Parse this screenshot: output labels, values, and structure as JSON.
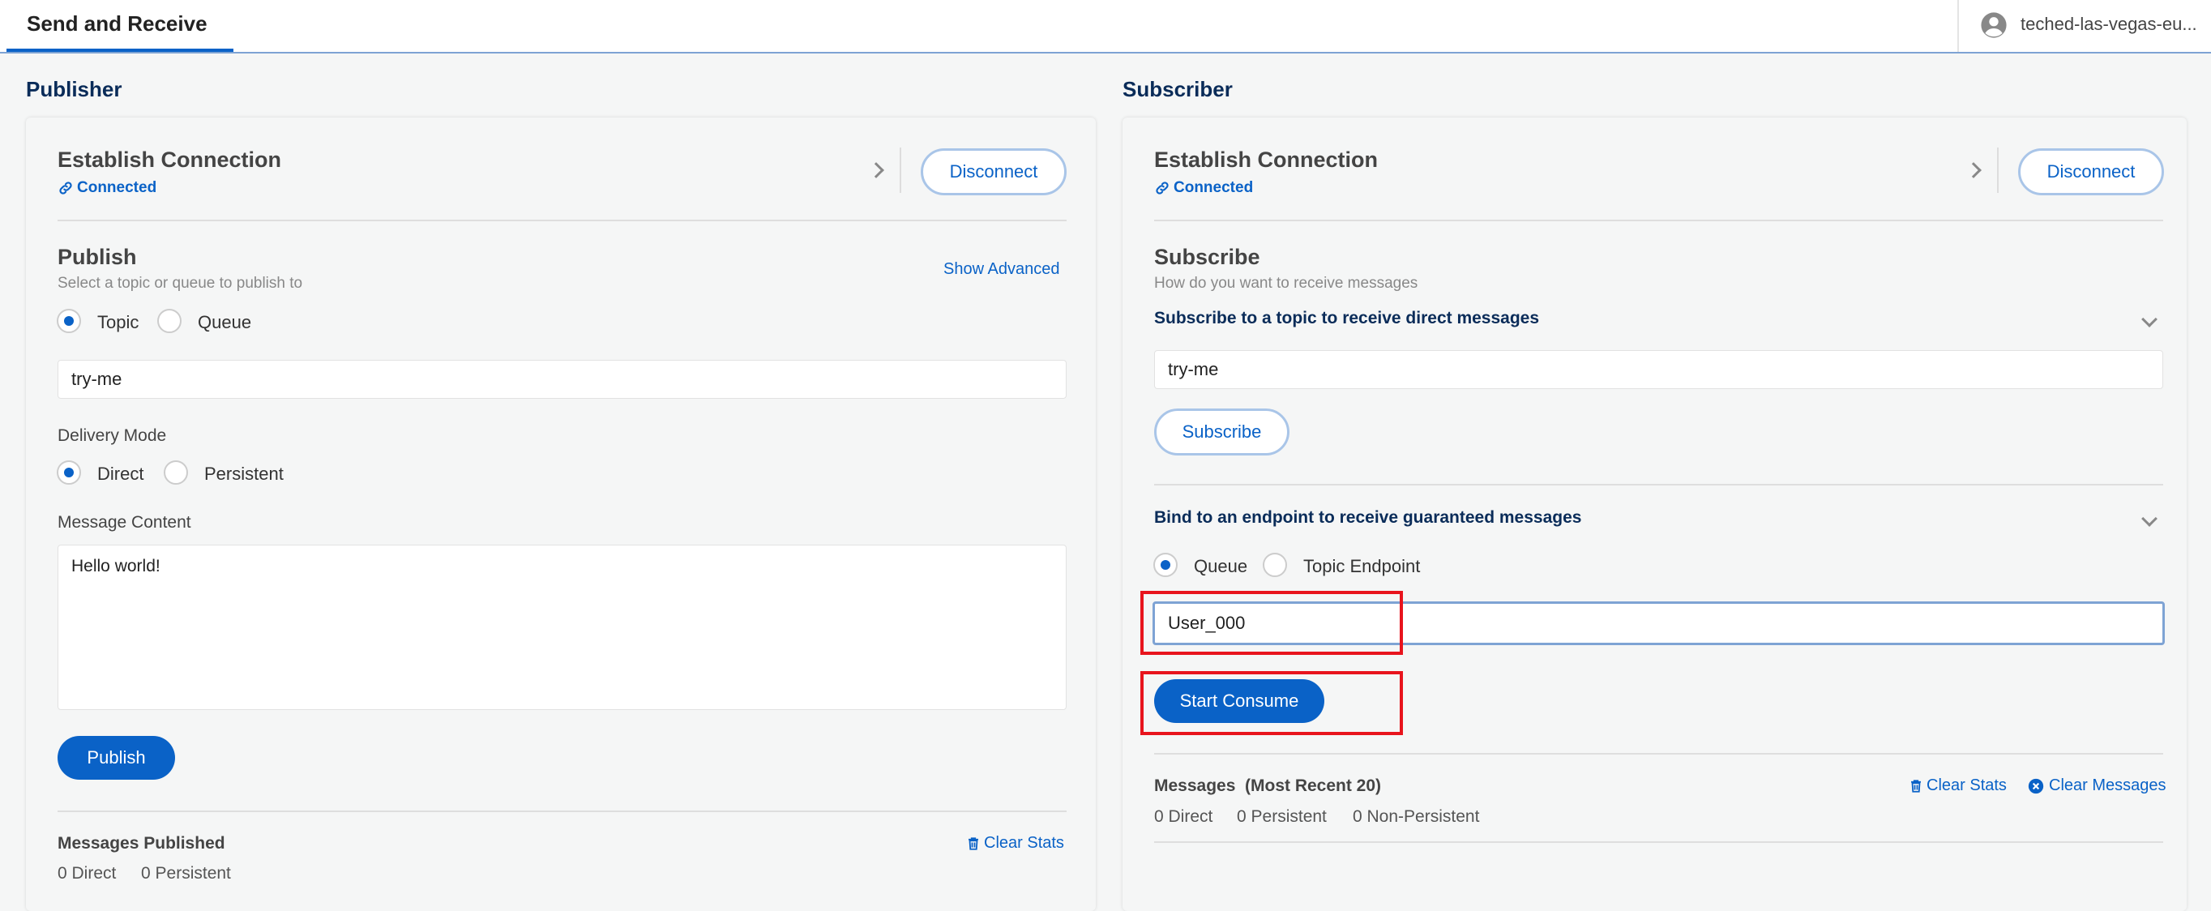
{
  "header": {
    "tab": "Send and Receive",
    "user": "teched-las-vegas-eu..."
  },
  "publisher": {
    "title": "Publisher",
    "connection_title": "Establish Connection",
    "connection_status": "Connected",
    "disconnect_label": "Disconnect",
    "publish_title": "Publish",
    "publish_subtitle": "Select a topic or queue to publish to",
    "show_advanced": "Show Advanced",
    "dest_options": [
      "Topic",
      "Queue"
    ],
    "dest_selected": "Topic",
    "topic_value": "try-me",
    "delivery_mode_label": "Delivery Mode",
    "delivery_options": [
      "Direct",
      "Persistent"
    ],
    "delivery_selected": "Direct",
    "message_content_label": "Message Content",
    "message_content": "Hello world!",
    "publish_button": "Publish",
    "stats_title": "Messages Published",
    "clear_stats": "Clear Stats",
    "stats_direct": "0 Direct",
    "stats_persistent": "0 Persistent"
  },
  "subscriber": {
    "title": "Subscriber",
    "connection_title": "Establish Connection",
    "connection_status": "Connected",
    "disconnect_label": "Disconnect",
    "subscribe_title": "Subscribe",
    "subscribe_subtitle": "How do you want to receive messages",
    "direct_heading": "Subscribe to a topic to receive direct messages",
    "topic_value": "try-me",
    "subscribe_button": "Subscribe",
    "guaranteed_heading": "Bind to an endpoint to receive guaranteed messages",
    "endpoint_options": [
      "Queue",
      "Topic Endpoint"
    ],
    "endpoint_selected": "Queue",
    "queue_value": "User_000",
    "start_consume_button": "Start Consume",
    "messages_title": "Messages",
    "messages_subtitle": "(Most Recent 20)",
    "clear_stats": "Clear Stats",
    "clear_messages": "Clear Messages",
    "stats_direct": "0 Direct",
    "stats_persistent": "0 Persistent",
    "stats_non_persistent": "0 Non-Persistent"
  },
  "colors": {
    "accent": "#0a62c7",
    "heading": "#0a2c59",
    "highlight": "#e8141d"
  }
}
